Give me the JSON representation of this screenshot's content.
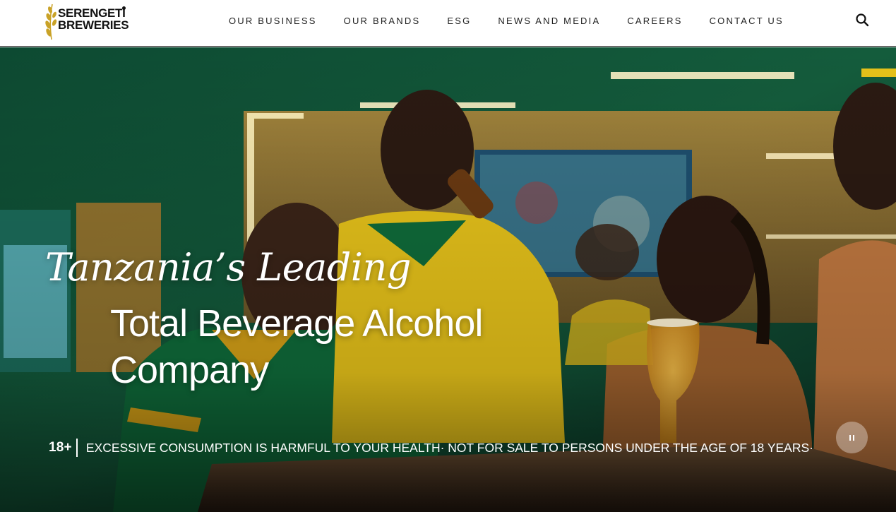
{
  "brand": {
    "line1": "SERENGETI",
    "line2": "BREWERIES",
    "wheat_color": "#c9a227"
  },
  "nav": {
    "items": [
      {
        "label": "OUR BUSINESS"
      },
      {
        "label": "OUR BRANDS"
      },
      {
        "label": "ESG"
      },
      {
        "label": "NEWS AND MEDIA"
      },
      {
        "label": "CAREERS"
      },
      {
        "label": "CONTACT US"
      }
    ],
    "search_icon": "search-icon"
  },
  "hero": {
    "tagline": "Tanzania’s Leading",
    "headline_line1": "Total Beverage Alcohol",
    "headline_line2": "Company",
    "age_label": "18+",
    "warning": "EXCESSIVE CONSUMPTION IS HARMFUL TO YOUR HEALTH· NOT FOR SALE TO PERSONS UNDER THE AGE OF 18 YEARS·",
    "pause_icon": "pause-icon",
    "video_state": "playing"
  },
  "colors": {
    "accent_yellow": "#f1c21b",
    "jersey_green": "#0f6b3a",
    "header_bg": "#ffffff",
    "nav_text": "#222222"
  }
}
